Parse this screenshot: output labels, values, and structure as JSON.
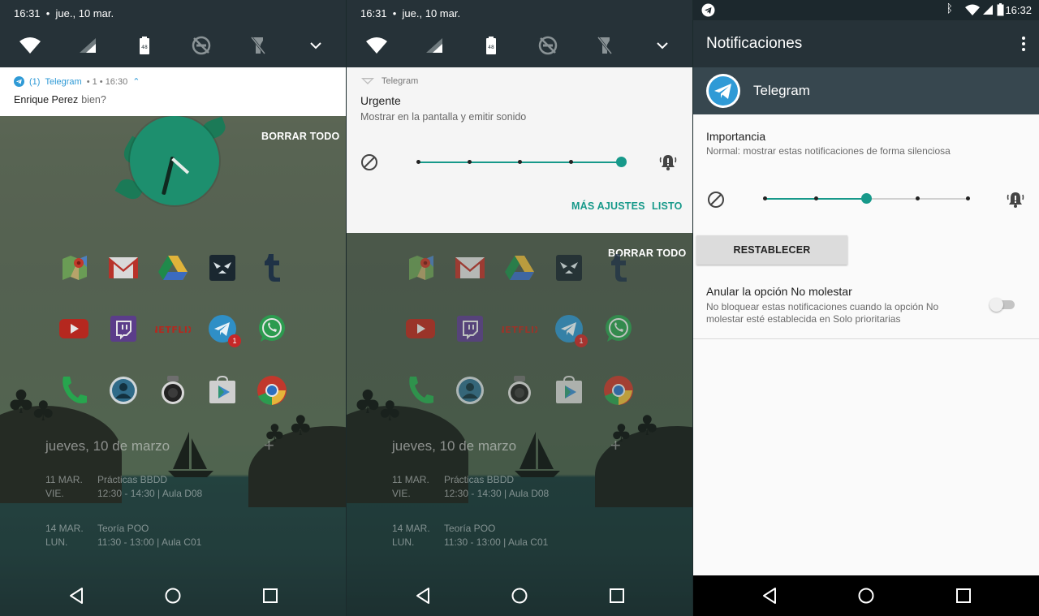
{
  "panel1": {
    "status_time": "16:31",
    "status_date": "jue., 10 mar.",
    "notification": {
      "count": "(1)",
      "app": "Telegram",
      "meta": "• 1 • 16:30",
      "sender": "Enrique Perez",
      "message": "bien?"
    },
    "clear_all": "BORRAR TODO",
    "agenda_date": "jueves, 10 de marzo",
    "events": [
      {
        "day": "11 MAR.",
        "weekday": "VIE.",
        "title": "Prácticas BBDD",
        "time": "12:30 - 14:30  |  Aula D08"
      },
      {
        "day": "14 MAR.",
        "weekday": "LUN.",
        "title": "Teoría POO",
        "time": "11:30 - 13:00  |  Aula C01"
      }
    ],
    "telegram_badge": "1"
  },
  "panel2": {
    "status_time": "16:31",
    "status_date": "jue., 10 mar.",
    "app": "Telegram",
    "importance_title": "Urgente",
    "importance_desc": "Mostrar en la pantalla y emitir sonido",
    "importance_level": 5,
    "more_settings": "MÁS AJUSTES",
    "done": "LISTO",
    "clear_all": "BORRAR TODO",
    "agenda_date": "jueves, 10 de marzo",
    "events": [
      {
        "day": "11 MAR.",
        "weekday": "VIE.",
        "title": "Prácticas BBDD",
        "time": "12:30 - 14:30  |  Aula D08"
      },
      {
        "day": "14 MAR.",
        "weekday": "LUN.",
        "title": "Teoría POO",
        "time": "11:30 - 13:00  |  Aula C01"
      }
    ],
    "telegram_badge": "1"
  },
  "panel3": {
    "status_time": "16:32",
    "title": "Notificaciones",
    "app_name": "Telegram",
    "importance_label": "Importancia",
    "importance_desc": "Normal: mostrar estas notificaciones de forma silenciosa",
    "importance_level": 3,
    "reset_label": "RESTABLECER",
    "dnd_label": "Anular la opción No molestar",
    "dnd_desc_1": "No bloquear estas notificaciones cuando la opción No",
    "dnd_desc_2": "molestar esté establecida en Solo prioritarias",
    "dnd_enabled": false
  },
  "colors": {
    "accent": "#17998a",
    "shade": "#263238",
    "telegram": "#2f9ad6"
  }
}
